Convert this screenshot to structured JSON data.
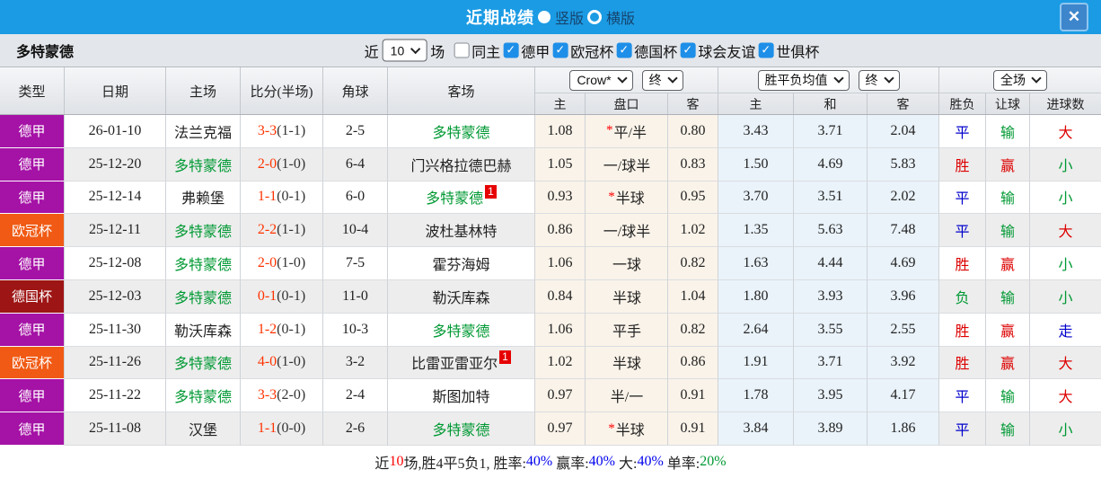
{
  "titlebar": {
    "title": "近期战绩",
    "layout_vertical": "竖版",
    "layout_horizontal": "横版"
  },
  "filterbar": {
    "team": "多特蒙德",
    "near_label": "近",
    "match_count": "10",
    "games_label": "场",
    "checkboxes": [
      {
        "label": "同主",
        "checked": false
      },
      {
        "label": "德甲",
        "checked": true
      },
      {
        "label": "欧冠杯",
        "checked": true
      },
      {
        "label": "德国杯",
        "checked": true
      },
      {
        "label": "球会友谊",
        "checked": true
      },
      {
        "label": "世俱杯",
        "checked": true
      }
    ]
  },
  "table": {
    "columns": [
      "类型",
      "日期",
      "主场",
      "比分(半场)",
      "角球",
      "客场"
    ],
    "dropdowns": {
      "company": "Crow*",
      "time1": "终",
      "avg": "胜平负均值",
      "time2": "终",
      "scope": "全场"
    },
    "subheaders": [
      "主",
      "盘口",
      "客",
      "主",
      "和",
      "客",
      "胜负",
      "让球",
      "进球数"
    ],
    "rows": [
      {
        "league": "德甲",
        "date": "26-01-10",
        "home": "法兰克福",
        "home_main": false,
        "home_badge": "",
        "score": "3-3",
        "half": "(1-1)",
        "corners": "2-5",
        "away": "多特蒙德",
        "away_main": true,
        "away_badge": "",
        "star": true,
        "ah_home": "1.08",
        "ah_line": "平/半",
        "ah_away": "0.80",
        "avg_home": "3.43",
        "avg_draw": "3.71",
        "avg_away": "2.04",
        "result": "平",
        "result_c": "blue",
        "handicap": "输",
        "handicap_c": "green",
        "goal": "大",
        "goal_c": "red"
      },
      {
        "league": "德甲",
        "date": "25-12-20",
        "home": "多特蒙德",
        "home_main": true,
        "home_badge": "",
        "score": "2-0",
        "half": "(1-0)",
        "corners": "6-4",
        "away": "门兴格拉德巴赫",
        "away_main": false,
        "away_badge": "",
        "star": false,
        "ah_home": "1.05",
        "ah_line": "一/球半",
        "ah_away": "0.83",
        "avg_home": "1.50",
        "avg_draw": "4.69",
        "avg_away": "5.83",
        "result": "胜",
        "result_c": "red",
        "handicap": "赢",
        "handicap_c": "red",
        "goal": "小",
        "goal_c": "green"
      },
      {
        "league": "德甲",
        "date": "25-12-14",
        "home": "弗赖堡",
        "home_main": false,
        "home_badge": "",
        "score": "1-1",
        "half": "(0-1)",
        "corners": "6-0",
        "away": "多特蒙德",
        "away_main": true,
        "away_badge": "1",
        "star": true,
        "ah_home": "0.93",
        "ah_line": "半球",
        "ah_away": "0.95",
        "avg_home": "3.70",
        "avg_draw": "3.51",
        "avg_away": "2.02",
        "result": "平",
        "result_c": "blue",
        "handicap": "输",
        "handicap_c": "green",
        "goal": "小",
        "goal_c": "green"
      },
      {
        "league": "欧冠杯",
        "date": "25-12-11",
        "home": "多特蒙德",
        "home_main": true,
        "home_badge": "",
        "score": "2-2",
        "half": "(1-1)",
        "corners": "10-4",
        "away": "波杜基林特",
        "away_main": false,
        "away_badge": "",
        "star": false,
        "ah_home": "0.86",
        "ah_line": "一/球半",
        "ah_away": "1.02",
        "avg_home": "1.35",
        "avg_draw": "5.63",
        "avg_away": "7.48",
        "result": "平",
        "result_c": "blue",
        "handicap": "输",
        "handicap_c": "green",
        "goal": "大",
        "goal_c": "red"
      },
      {
        "league": "德甲",
        "date": "25-12-08",
        "home": "多特蒙德",
        "home_main": true,
        "home_badge": "",
        "score": "2-0",
        "half": "(1-0)",
        "corners": "7-5",
        "away": "霍芬海姆",
        "away_main": false,
        "away_badge": "",
        "star": false,
        "ah_home": "1.06",
        "ah_line": "一球",
        "ah_away": "0.82",
        "avg_home": "1.63",
        "avg_draw": "4.44",
        "avg_away": "4.69",
        "result": "胜",
        "result_c": "red",
        "handicap": "赢",
        "handicap_c": "red",
        "goal": "小",
        "goal_c": "green"
      },
      {
        "league": "德国杯",
        "date": "25-12-03",
        "home": "多特蒙德",
        "home_main": true,
        "home_badge": "",
        "score": "0-1",
        "half": "(0-1)",
        "corners": "11-0",
        "away": "勒沃库森",
        "away_main": false,
        "away_badge": "",
        "star": false,
        "ah_home": "0.84",
        "ah_line": "半球",
        "ah_away": "1.04",
        "avg_home": "1.80",
        "avg_draw": "3.93",
        "avg_away": "3.96",
        "result": "负",
        "result_c": "green",
        "handicap": "输",
        "handicap_c": "green",
        "goal": "小",
        "goal_c": "green"
      },
      {
        "league": "德甲",
        "date": "25-11-30",
        "home": "勒沃库森",
        "home_main": false,
        "home_badge": "",
        "score": "1-2",
        "half": "(0-1)",
        "corners": "10-3",
        "away": "多特蒙德",
        "away_main": true,
        "away_badge": "",
        "star": false,
        "ah_home": "1.06",
        "ah_line": "平手",
        "ah_away": "0.82",
        "avg_home": "2.64",
        "avg_draw": "3.55",
        "avg_away": "2.55",
        "result": "胜",
        "result_c": "red",
        "handicap": "赢",
        "handicap_c": "red",
        "goal": "走",
        "goal_c": "blue"
      },
      {
        "league": "欧冠杯",
        "date": "25-11-26",
        "home": "多特蒙德",
        "home_main": true,
        "home_badge": "",
        "score": "4-0",
        "half": "(1-0)",
        "corners": "3-2",
        "away": "比雷亚雷亚尔",
        "away_main": false,
        "away_badge": "1",
        "star": false,
        "ah_home": "1.02",
        "ah_line": "半球",
        "ah_away": "0.86",
        "avg_home": "1.91",
        "avg_draw": "3.71",
        "avg_away": "3.92",
        "result": "胜",
        "result_c": "red",
        "handicap": "赢",
        "handicap_c": "red",
        "goal": "大",
        "goal_c": "red"
      },
      {
        "league": "德甲",
        "date": "25-11-22",
        "home": "多特蒙德",
        "home_main": true,
        "home_badge": "",
        "score": "3-3",
        "half": "(2-0)",
        "corners": "2-4",
        "away": "斯图加特",
        "away_main": false,
        "away_badge": "",
        "star": false,
        "ah_home": "0.97",
        "ah_line": "半/一",
        "ah_away": "0.91",
        "avg_home": "1.78",
        "avg_draw": "3.95",
        "avg_away": "4.17",
        "result": "平",
        "result_c": "blue",
        "handicap": "输",
        "handicap_c": "green",
        "goal": "大",
        "goal_c": "red"
      },
      {
        "league": "德甲",
        "date": "25-11-08",
        "home": "汉堡",
        "home_main": false,
        "home_badge": "",
        "score": "1-1",
        "half": "(0-0)",
        "corners": "2-6",
        "away": "多特蒙德",
        "away_main": true,
        "away_badge": "",
        "star": true,
        "ah_home": "0.97",
        "ah_line": "半球",
        "ah_away": "0.91",
        "avg_home": "3.84",
        "avg_draw": "3.89",
        "avg_away": "1.86",
        "result": "平",
        "result_c": "blue",
        "handicap": "输",
        "handicap_c": "green",
        "goal": "小",
        "goal_c": "green"
      }
    ]
  },
  "summary": {
    "parts": [
      {
        "text": "近",
        "color": "black"
      },
      {
        "text": "10",
        "color": "summary_red"
      },
      {
        "text": "场,胜4平5负1, 胜率:",
        "color": "black"
      },
      {
        "text": "40%",
        "color": "summary_blue"
      },
      {
        "text": " 赢率:",
        "color": "black"
      },
      {
        "text": "40%",
        "color": "summary_blue"
      },
      {
        "text": " 大:",
        "color": "black"
      },
      {
        "text": "40%",
        "color": "summary_blue"
      },
      {
        "text": " 单率:",
        "color": "black"
      },
      {
        "text": "20%",
        "color": "green"
      }
    ]
  },
  "colors": {
    "black": "#222222",
    "red": "#DD0000",
    "blue": "#0000CC",
    "green": "#009933",
    "summary_red": "#FF0000",
    "summary_blue": "#0000EE",
    "score_red": "#FF3300",
    "team_green": "#009933",
    "star_red": "#FF0000",
    "accent": "#1B9BE4",
    "league": {
      "德甲": "#A512A6",
      "欧冠杯": "#F05A14",
      "德国杯": "#9E1515"
    }
  }
}
